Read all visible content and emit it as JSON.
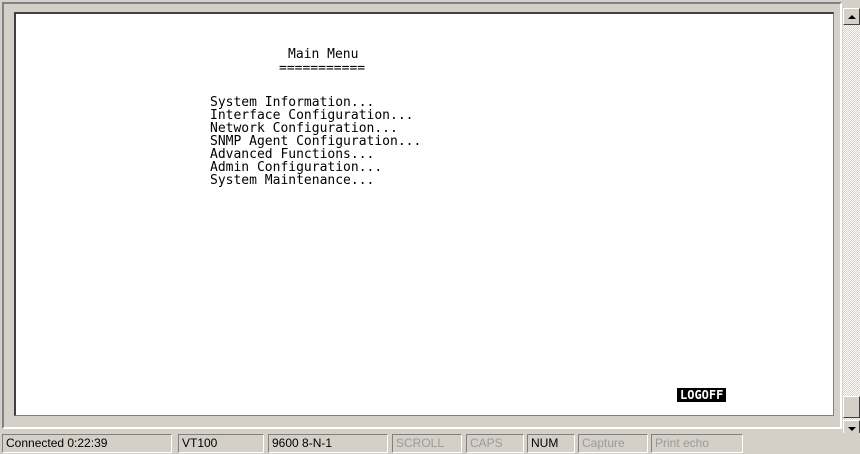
{
  "terminal": {
    "title": "Main Menu",
    "underline": "===========",
    "menu_items": [
      "System Information...",
      "Interface Configuration...",
      "Network Configuration...",
      "SNMP Agent Configuration...",
      "Advanced Functions...",
      "Admin Configuration...",
      "System Maintenance..."
    ],
    "logoff_label": "LOGOFF"
  },
  "scrollbar": {
    "up_icon": "arrow-up-icon",
    "down_icon": "arrow-down-icon"
  },
  "status_bar": {
    "connection": "Connected 0:22:39",
    "emulation": "VT100",
    "port_settings": "9600 8-N-1",
    "scroll": "SCROLL",
    "caps": "CAPS",
    "num": "NUM",
    "capture": "Capture",
    "print_echo": "Print echo"
  },
  "colors": {
    "window_face": "#d4d0c8",
    "terminal_bg": "#ffffff",
    "terminal_fg": "#000000",
    "logoff_bg": "#000000",
    "logoff_fg": "#ffffff",
    "inactive_indicator": "#9a9a9a"
  }
}
